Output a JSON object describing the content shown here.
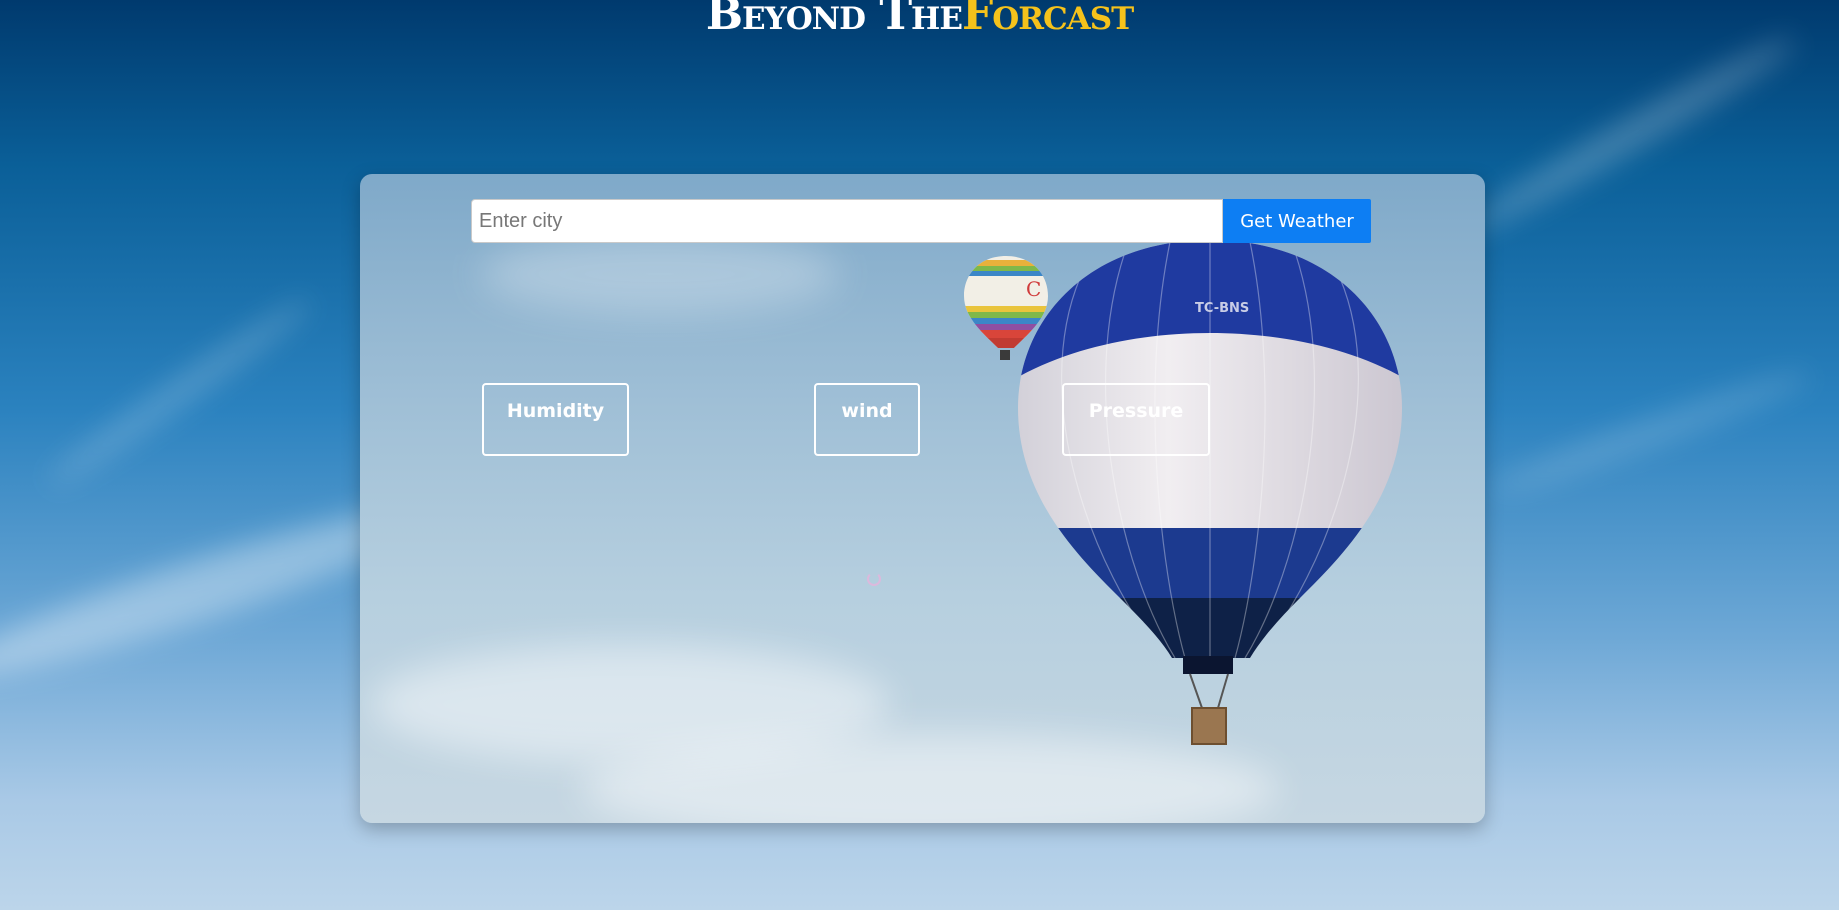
{
  "header": {
    "title_main": "Beyond The",
    "title_accent": "Forcast"
  },
  "search": {
    "placeholder": "Enter city",
    "value": "",
    "button_label": "Get Weather"
  },
  "metrics": {
    "humidity_label": "Humidity",
    "wind_label": "wind",
    "pressure_label": "Pressure"
  },
  "balloon": {
    "registration": "TC-BNS"
  },
  "colors": {
    "accent": "#f5c21b",
    "button": "#0d7ef3",
    "sky_top": "#003a6e"
  }
}
